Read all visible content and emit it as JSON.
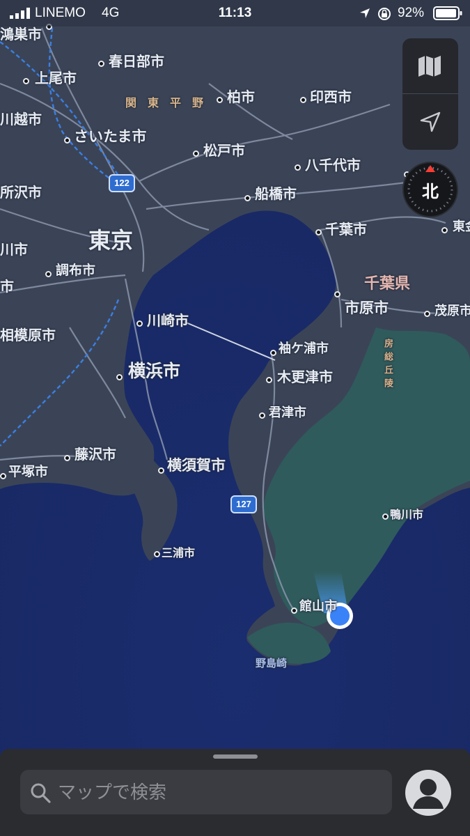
{
  "status_bar": {
    "carrier": "LINEMO",
    "network": "4G",
    "time": "11:13",
    "battery": "92%"
  },
  "map": {
    "colors": {
      "sea": "#1f3577",
      "land": "#3a4356",
      "forest": "#2f5a5a",
      "road": "#8590a6",
      "rail": "#3a7de0",
      "user": "#3a82f7"
    },
    "labels": [
      {
        "key": "konosu",
        "text": "鴻巣市"
      },
      {
        "key": "kasukabe",
        "text": "春日部市"
      },
      {
        "key": "ageo",
        "text": "上尾市"
      },
      {
        "key": "kanto_plain",
        "text": "関　東　平　野"
      },
      {
        "key": "kashiwa",
        "text": "柏市"
      },
      {
        "key": "inzai",
        "text": "印西市"
      },
      {
        "key": "kawagoe",
        "text": "川越市"
      },
      {
        "key": "saitama",
        "text": "さいたま市"
      },
      {
        "key": "matsudo",
        "text": "松戸市"
      },
      {
        "key": "yachiyo",
        "text": "八千代市"
      },
      {
        "key": "tokorozawa",
        "text": "所沢市"
      },
      {
        "key": "funabashi",
        "text": "船橋市"
      },
      {
        "key": "tokyo",
        "text": "東京"
      },
      {
        "key": "chiba",
        "text": "千葉市"
      },
      {
        "key": "togane",
        "text": "東金"
      },
      {
        "key": "ome_fragment",
        "text": "川市"
      },
      {
        "key": "chofu",
        "text": "調布市"
      },
      {
        "key": "chiba_pref",
        "text": "千葉県"
      },
      {
        "key": "fuchu_fragment",
        "text": "市"
      },
      {
        "key": "ichihara",
        "text": "市原市"
      },
      {
        "key": "mobara",
        "text": "茂原市"
      },
      {
        "key": "kawasaki",
        "text": "川崎市"
      },
      {
        "key": "sagamihara",
        "text": "相模原市"
      },
      {
        "key": "sodegaura",
        "text": "袖ケ浦市"
      },
      {
        "key": "yokohama",
        "text": "横浜市"
      },
      {
        "key": "kisarazu",
        "text": "木更津市"
      },
      {
        "key": "kimitsu",
        "text": "君津市"
      },
      {
        "key": "fujisawa",
        "text": "藤沢市"
      },
      {
        "key": "hiratsuka",
        "text": "平塚市"
      },
      {
        "key": "yokosuka",
        "text": "横須賀市"
      },
      {
        "key": "kamogawa",
        "text": "鴨川市"
      },
      {
        "key": "miura",
        "text": "三浦市"
      },
      {
        "key": "tateyama",
        "text": "館山市"
      },
      {
        "key": "nojimazaki",
        "text": "野島崎"
      },
      {
        "key": "boso_hills",
        "text": "房総丘陵"
      }
    ],
    "route_shields": [
      {
        "key": "r122",
        "text": "122"
      },
      {
        "key": "r127",
        "text": "127"
      }
    ]
  },
  "controls": {
    "map_mode_icon": "map-icon",
    "location_icon": "location-arrow-icon",
    "compass_label": "北"
  },
  "search": {
    "placeholder": "マップで検索"
  }
}
